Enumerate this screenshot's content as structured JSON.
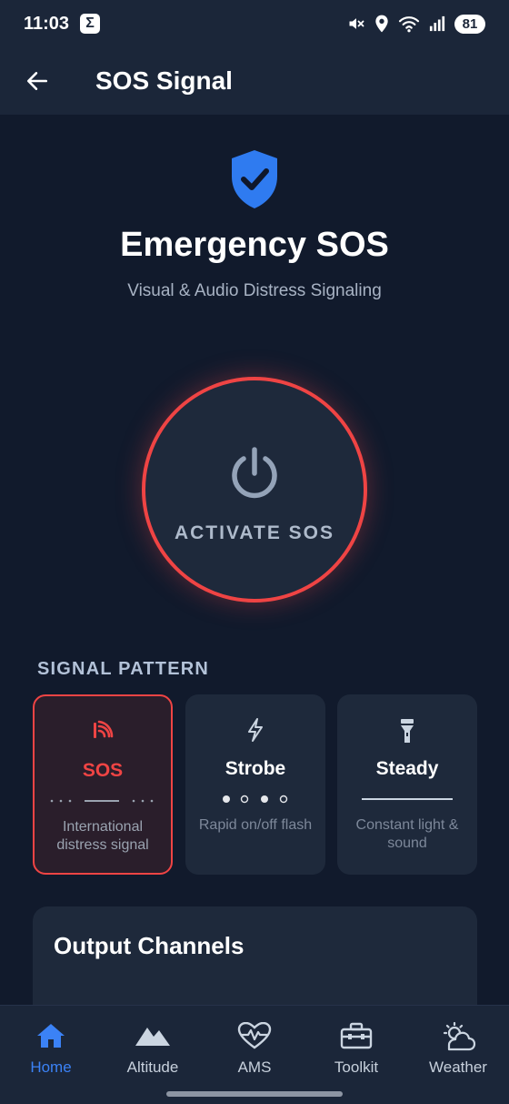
{
  "status_bar": {
    "time": "11:03",
    "sigma": "Σ",
    "battery": "81",
    "icons": [
      "mute-icon",
      "location-icon",
      "wifi-icon",
      "signal-icon"
    ]
  },
  "app_bar": {
    "title": "SOS Signal",
    "back_icon": "arrow-left-icon"
  },
  "hero": {
    "icon": "shield-check-icon",
    "title": "Emergency SOS",
    "subtitle": "Visual & Audio Distress Signaling"
  },
  "sos_button": {
    "icon": "power-icon",
    "label": "ACTIVATE SOS",
    "ring_color": "#ef4444"
  },
  "signal_pattern": {
    "label": "SIGNAL PATTERN",
    "patterns": [
      {
        "name": "SOS",
        "description": "International distress signal",
        "icon": "broadcast-icon",
        "selected": true
      },
      {
        "name": "Strobe",
        "description": "Rapid on/off flash",
        "icon": "lightning-icon",
        "selected": false
      },
      {
        "name": "Steady",
        "description": "Constant light & sound",
        "icon": "flashlight-icon",
        "selected": false
      }
    ]
  },
  "output_channels": {
    "title": "Output Channels"
  },
  "bottom_nav": {
    "items": [
      {
        "label": "Home",
        "icon": "home-icon",
        "active": true
      },
      {
        "label": "Altitude",
        "icon": "mountain-icon",
        "active": false
      },
      {
        "label": "AMS",
        "icon": "heartbeat-icon",
        "active": false
      },
      {
        "label": "Toolkit",
        "icon": "toolbox-icon",
        "active": false
      },
      {
        "label": "Weather",
        "icon": "weather-icon",
        "active": false
      }
    ]
  },
  "colors": {
    "background": "#111a2c",
    "surface": "#1e293b",
    "accent_red": "#ef4444",
    "accent_blue": "#3b82f6"
  }
}
